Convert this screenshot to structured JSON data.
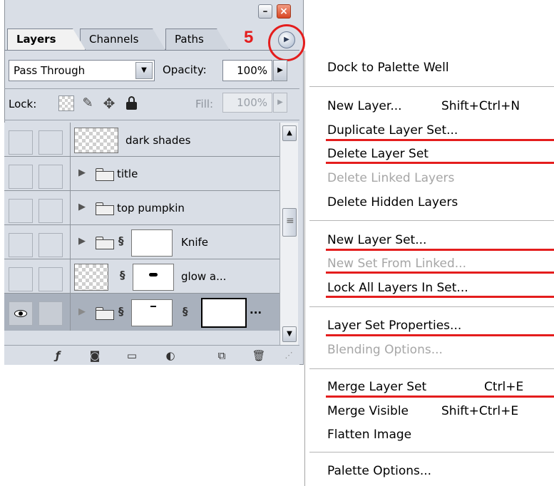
{
  "palette": {
    "tabs": [
      {
        "label": "Layers"
      },
      {
        "label": "Channels"
      },
      {
        "label": "Paths"
      }
    ],
    "step_number": "5",
    "blend_mode": "Pass Through",
    "opacity_label": "Opacity:",
    "opacity_value": "100%",
    "lock_label": "Lock:",
    "fill_label": "Fill:",
    "fill_value": "100%",
    "layers": [
      {
        "name": "dark shades"
      },
      {
        "name": "title"
      },
      {
        "name": "top pumpkin"
      },
      {
        "name": "Knife"
      },
      {
        "name": "glow a..."
      },
      {
        "name": "..."
      }
    ]
  },
  "menu": {
    "items": [
      {
        "label": "Dock to Palette Well",
        "shortcut": "",
        "enabled": true
      },
      {
        "label": "New Layer...",
        "shortcut": "Shift+Ctrl+N",
        "enabled": true
      },
      {
        "label": "Duplicate Layer Set...",
        "shortcut": "",
        "enabled": true
      },
      {
        "label": "Delete Layer Set",
        "shortcut": "",
        "enabled": true
      },
      {
        "label": "Delete Linked Layers",
        "shortcut": "",
        "enabled": false
      },
      {
        "label": "Delete Hidden Layers",
        "shortcut": "",
        "enabled": true
      },
      {
        "label": "New Layer Set...",
        "shortcut": "",
        "enabled": true
      },
      {
        "label": "New Set From Linked...",
        "shortcut": "",
        "enabled": false
      },
      {
        "label": "Lock All Layers In Set...",
        "shortcut": "",
        "enabled": true
      },
      {
        "label": "Layer Set Properties...",
        "shortcut": "",
        "enabled": true
      },
      {
        "label": "Blending Options...",
        "shortcut": "",
        "enabled": false
      },
      {
        "label": "Merge Layer Set",
        "shortcut": "Ctrl+E",
        "enabled": true
      },
      {
        "label": "Merge Visible",
        "shortcut": "Shift+Ctrl+E",
        "enabled": true
      },
      {
        "label": "Flatten Image",
        "shortcut": "",
        "enabled": true
      },
      {
        "label": "Palette Options...",
        "shortcut": "",
        "enabled": true
      }
    ]
  },
  "colors": {
    "annotation_red": "#e41d1d",
    "palette_bg": "#d9dee6",
    "selected_row": "#a9b1bd",
    "disabled_text": "#a6a6a6"
  }
}
